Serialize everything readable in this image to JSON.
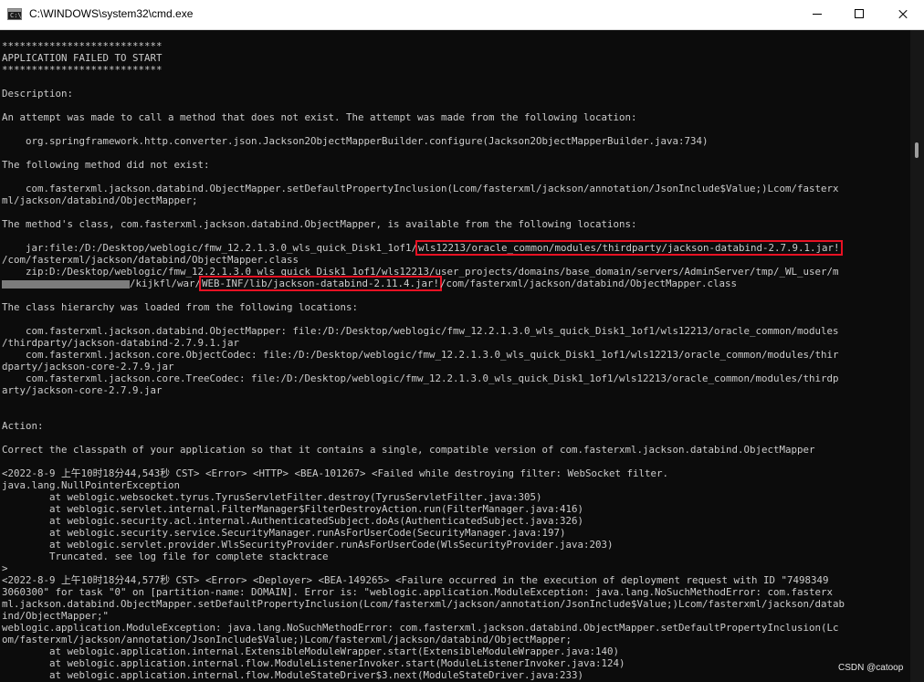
{
  "window": {
    "title": "C:\\WINDOWS\\system32\\cmd.exe",
    "icon": "cmd-icon",
    "controls": [
      "minimize-icon",
      "maximize-icon",
      "close-icon"
    ]
  },
  "console": {
    "lines": [
      "***************************",
      "APPLICATION FAILED TO START",
      "***************************",
      "",
      "Description:",
      "",
      "An attempt was made to call a method that does not exist. The attempt was made from the following location:",
      "",
      "    org.springframework.http.converter.json.Jackson2ObjectMapperBuilder.configure(Jackson2ObjectMapperBuilder.java:734)",
      "",
      "The following method did not exist:",
      "",
      "    com.fasterxml.jackson.databind.ObjectMapper.setDefaultPropertyInclusion(Lcom/fasterxml/jackson/annotation/JsonInclude$Value;)Lcom/fasterx",
      "ml/jackson/databind/ObjectMapper;",
      "",
      "The method's class, com.fasterxml.jackson.databind.ObjectMapper, is available from the following locations:",
      "",
      "",
      "/com/fasterxml/jackson/databind/ObjectMapper.class",
      "    zip:D:/Desktop/weblogic/fmw_12.2.1.3.0_wls_quick_Disk1_1of1/wls12213/user_projects/domains/base_domain/servers/AdminServer/tmp/_WL_user/m",
      "",
      "",
      "The class hierarchy was loaded from the following locations:",
      "",
      "    com.fasterxml.jackson.databind.ObjectMapper: file:/D:/Desktop/weblogic/fmw_12.2.1.3.0_wls_quick_Disk1_1of1/wls12213/oracle_common/modules",
      "/thirdparty/jackson-databind-2.7.9.1.jar",
      "    com.fasterxml.jackson.core.ObjectCodec: file:/D:/Desktop/weblogic/fmw_12.2.1.3.0_wls_quick_Disk1_1of1/wls12213/oracle_common/modules/thir",
      "dparty/jackson-core-2.7.9.jar",
      "    com.fasterxml.jackson.core.TreeCodec: file:/D:/Desktop/weblogic/fmw_12.2.1.3.0_wls_quick_Disk1_1of1/wls12213/oracle_common/modules/thirdp",
      "arty/jackson-core-2.7.9.jar",
      "",
      "",
      "Action:",
      "",
      "Correct the classpath of your application so that it contains a single, compatible version of com.fasterxml.jackson.databind.ObjectMapper",
      "",
      "<2022-8-9 上午10时18分44,543秒 CST> <Error> <HTTP> <BEA-101267> <Failed while destroying filter: WebSocket filter.",
      "java.lang.NullPointerException",
      "        at weblogic.websocket.tyrus.TyrusServletFilter.destroy(TyrusServletFilter.java:305)",
      "        at weblogic.servlet.internal.FilterManager$FilterDestroyAction.run(FilterManager.java:416)",
      "        at weblogic.security.acl.internal.AuthenticatedSubject.doAs(AuthenticatedSubject.java:326)",
      "        at weblogic.security.service.SecurityManager.runAsForUserCode(SecurityManager.java:197)",
      "        at weblogic.servlet.provider.WlsSecurityProvider.runAsForUserCode(WlsSecurityProvider.java:203)",
      "        Truncated. see log file for complete stacktrace",
      ">",
      "<2022-8-9 上午10时18分44,577秒 CST> <Error> <Deployer> <BEA-149265> <Failure occurred in the execution of deployment request with ID \"7498349",
      "3060300\" for task \"0\" on [partition-name: DOMAIN]. Error is: \"weblogic.application.ModuleException: java.lang.NoSuchMethodError: com.fasterx",
      "ml.jackson.databind.ObjectMapper.setDefaultPropertyInclusion(Lcom/fasterxml/jackson/annotation/JsonInclude$Value;)Lcom/fasterxml/jackson/datab",
      "ind/ObjectMapper;\"",
      "weblogic.application.ModuleException: java.lang.NoSuchMethodError: com.fasterxml.jackson.databind.ObjectMapper.setDefaultPropertyInclusion(Lc",
      "om/fasterxml/jackson/annotation/JsonInclude$Value;)Lcom/fasterxml/jackson/databind/ObjectMapper;",
      "        at weblogic.application.internal.ExtensibleModuleWrapper.start(ExtensibleModuleWrapper.java:140)",
      "        at weblogic.application.internal.flow.ModuleListenerInvoker.start(ModuleListenerInvoker.java:124)",
      "        at weblogic.application.internal.flow.ModuleStateDriver$3.next(ModuleStateDriver.java:233)"
    ],
    "jar_line": {
      "prefix": "    jar:file:/D:/Desktop/weblogic/fmw_12.2.1.3.0_wls_quick_Disk1_1of1/",
      "highlight": "wls12213/oracle_common/modules/thirdparty/jackson-databind-2.7.9.1.jar!"
    },
    "war_line": {
      "prefix": "/kijkfl/war/",
      "highlight": "WEB-INF/lib/jackson-databind-2.11.4.jar!",
      "suffix": "/com/fasterxml/jackson/databind/ObjectMapper.class"
    }
  },
  "watermark": "CSDN @catoop"
}
